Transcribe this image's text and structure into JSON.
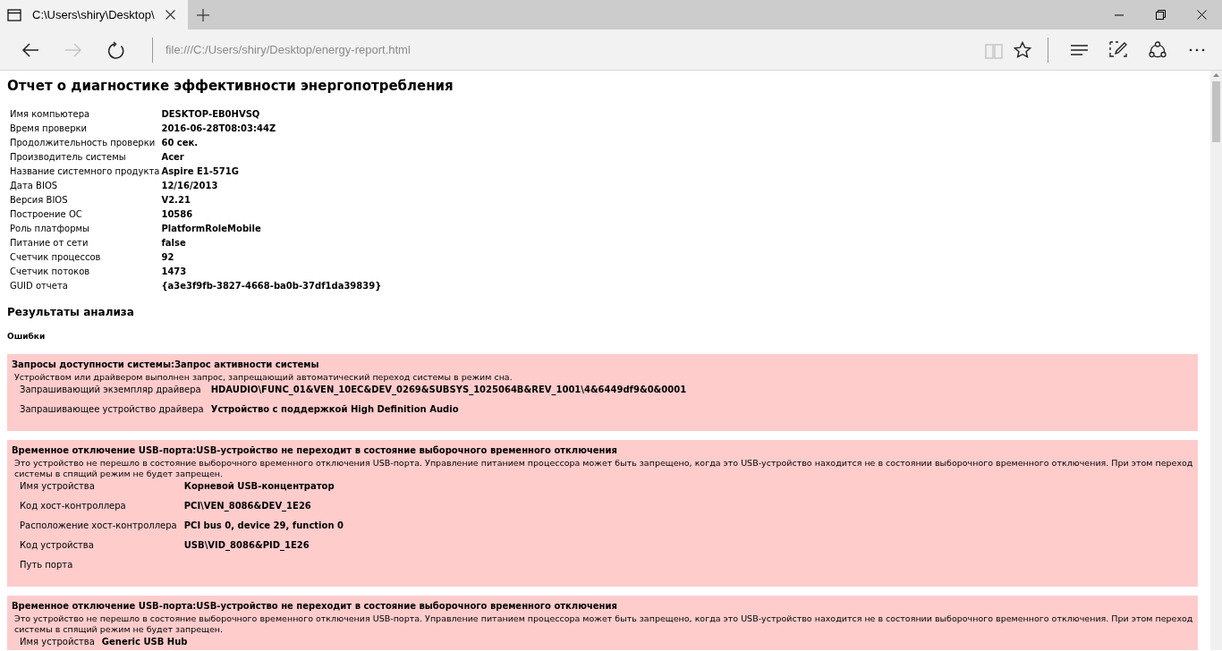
{
  "tab": {
    "title": "C:\\Users\\shiry\\Desktop\\",
    "selected": true
  },
  "toolbar": {
    "buttons": [
      {
        "kind": "back",
        "disabled": false
      },
      {
        "kind": "forward",
        "disabled": true
      },
      {
        "kind": "refresh",
        "disabled": false
      }
    ],
    "address": "file:///C:/Users/shiry/Desktop/energy-report.html",
    "right_buttons": [
      {
        "kind": "reading",
        "disabled": true
      },
      {
        "kind": "star",
        "disabled": false
      },
      {
        "kind": "hub",
        "disabled": false
      },
      {
        "kind": "note",
        "disabled": false
      },
      {
        "kind": "share",
        "disabled": false
      },
      {
        "kind": "more",
        "disabled": false
      }
    ]
  },
  "report": {
    "title": "Отчет о диагностике эффективности энергопотребления",
    "info": [
      {
        "label": "Имя компьютера",
        "value": "DESKTOP-EB0HVSQ"
      },
      {
        "label": "Время проверки",
        "value": "2016-06-28T08:03:44Z"
      },
      {
        "label": "Продолжительность проверки",
        "value": "60 сек."
      },
      {
        "label": "Производитель системы",
        "value": "Acer"
      },
      {
        "label": "Название системного продукта",
        "value": "Aspire E1-571G"
      },
      {
        "label": "Дата BIOS",
        "value": "12/16/2013"
      },
      {
        "label": "Версия BIOS",
        "value": "V2.21"
      },
      {
        "label": "Построение ОС",
        "value": "10586"
      },
      {
        "label": "Роль платформы",
        "value": "PlatformRoleMobile"
      },
      {
        "label": "Питание от сети",
        "value": "false"
      },
      {
        "label": "Счетчик процессов",
        "value": "92"
      },
      {
        "label": "Счетчик потоков",
        "value": "1473"
      },
      {
        "label": "GUID отчета",
        "value": "{a3e3f9fb-3827-4668-ba0b-37df1da39839}"
      }
    ],
    "results_heading": "Результаты анализа",
    "errors_heading": "Ошибки",
    "errors": [
      {
        "title": "Запросы доступности системы:Запрос активности системы",
        "description": "Устройством или драйвером выполнен запрос, запрещающий автоматический переход системы в режим сна.",
        "rows": [
          {
            "label": "Запрашивающий экземпляр драйвера",
            "value": "HDAUDIO\\FUNC_01&VEN_10EC&DEV_0269&SUBSYS_1025064B&REV_1001\\4&6449df9&0&0001"
          },
          {
            "label": "Запрашивающее устройство драйвера",
            "value": "Устройство с поддержкой High Definition Audio"
          }
        ]
      },
      {
        "title": "Временное отключение USB-порта:USB-устройство не переходит в состояние выборочного временного отключения",
        "description": "Это устройство не перешло в состояние выборочного временного отключения USB-порта. Управление питанием процессора может быть запрещено, когда это USB-устройство находится не в состоянии выборочного временного отключения. При этом переход системы в спящий режим не будет запрещен.",
        "rows": [
          {
            "label": "Имя устройства",
            "value": "Корневой USB-концентратор"
          },
          {
            "label": "Код хост-контроллера",
            "value": "PCI\\VEN_8086&DEV_1E26"
          },
          {
            "label": "Расположение хост-контроллера",
            "value": "PCI bus 0, device 29, function 0"
          },
          {
            "label": "Код устройства",
            "value": "USB\\VID_8086&PID_1E26"
          },
          {
            "label": "Путь порта"
          }
        ]
      },
      {
        "title": "Временное отключение USB-порта:USB-устройство не переходит в состояние выборочного временного отключения",
        "description": "Это устройство не перешло в состояние выборочного временного отключения USB-порта. Управление питанием процессора может быть запрещено, когда это USB-устройство находится не в состоянии выборочного временного отключения. При этом переход системы в спящий режим не будет запрещен.",
        "rows": [
          {
            "label": "Имя устройства",
            "value": "Generic USB Hub"
          }
        ]
      }
    ]
  }
}
